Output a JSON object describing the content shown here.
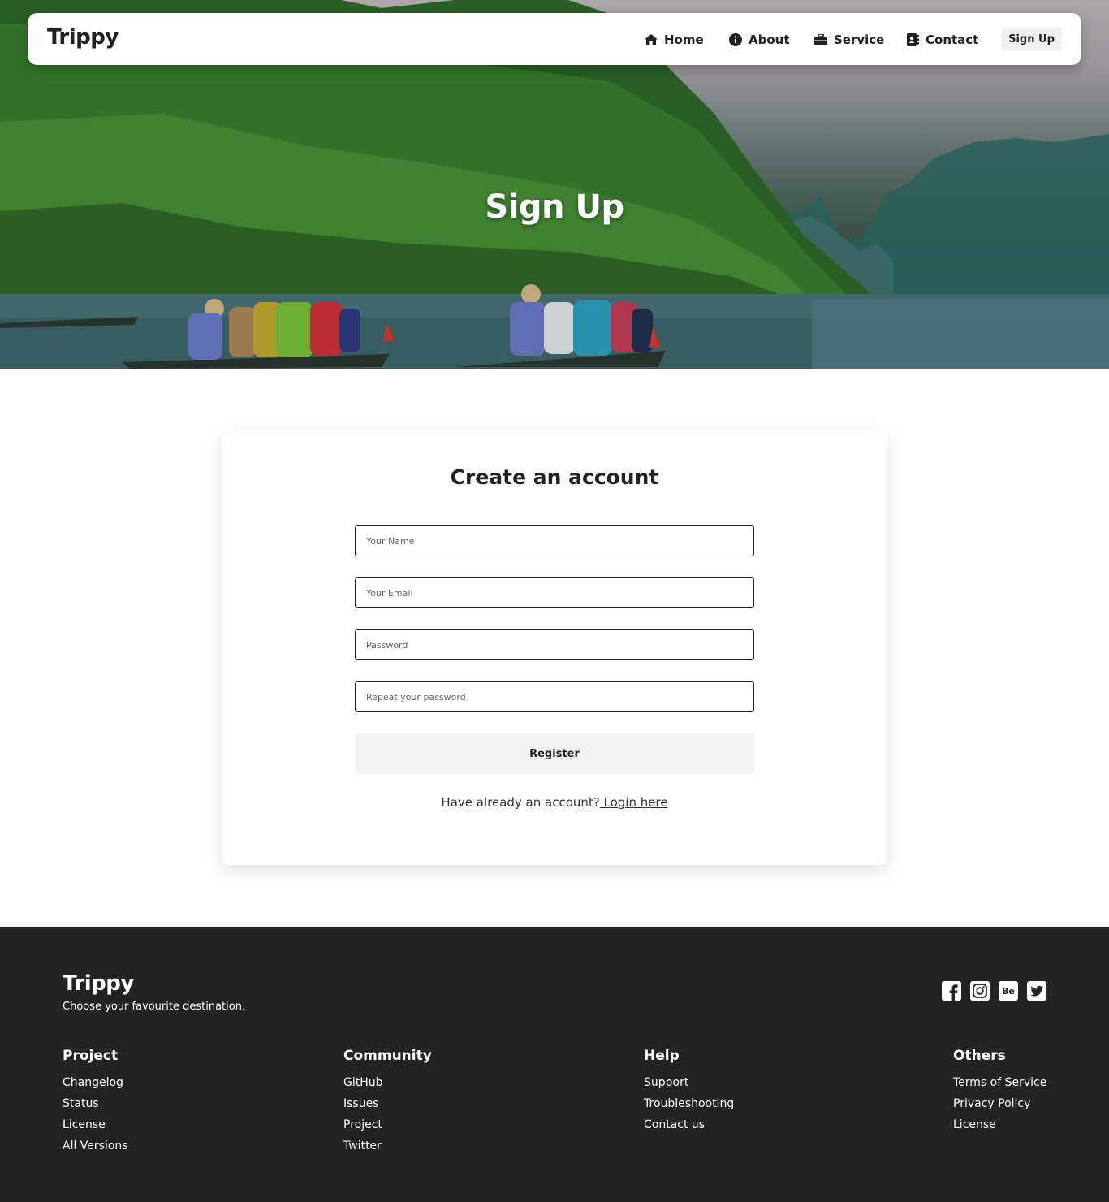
{
  "brand": {
    "name": "Trippy"
  },
  "nav": {
    "items": [
      {
        "label": "Home",
        "icon": "home-icon"
      },
      {
        "label": "About",
        "icon": "info-icon"
      },
      {
        "label": "Service",
        "icon": "briefcase-icon"
      },
      {
        "label": "Contact",
        "icon": "contact-book-icon"
      }
    ],
    "signup_label": "Sign Up"
  },
  "hero": {
    "title": "Sign Up"
  },
  "form": {
    "title": "Create an account",
    "name_placeholder": "Your Name",
    "email_placeholder": "Your Email",
    "password_placeholder": "Password",
    "repeat_password_placeholder": "Repeat your password",
    "register_label": "Register",
    "login_prompt": "Have already an account?",
    "login_link": " Login here"
  },
  "footer": {
    "brand": "Trippy",
    "tagline": "Choose your favourite destination.",
    "socials": [
      "facebook-icon",
      "instagram-icon",
      "behance-icon",
      "twitter-icon"
    ],
    "behance_text": "Be",
    "columns": [
      {
        "title": "Project",
        "links": [
          "Changelog",
          "Status",
          "License",
          "All Versions"
        ]
      },
      {
        "title": "Community",
        "links": [
          "GitHub",
          "Issues",
          "Project",
          "Twitter"
        ]
      },
      {
        "title": "Help",
        "links": [
          "Support",
          "Troubleshooting",
          "Contact us"
        ]
      },
      {
        "title": "Others",
        "links": [
          "Terms of Service",
          "Privacy Policy",
          "License"
        ]
      }
    ]
  },
  "colors": {
    "footer_bg": "#232323",
    "button_bg": "#f1f1f1",
    "text": "#222222"
  }
}
